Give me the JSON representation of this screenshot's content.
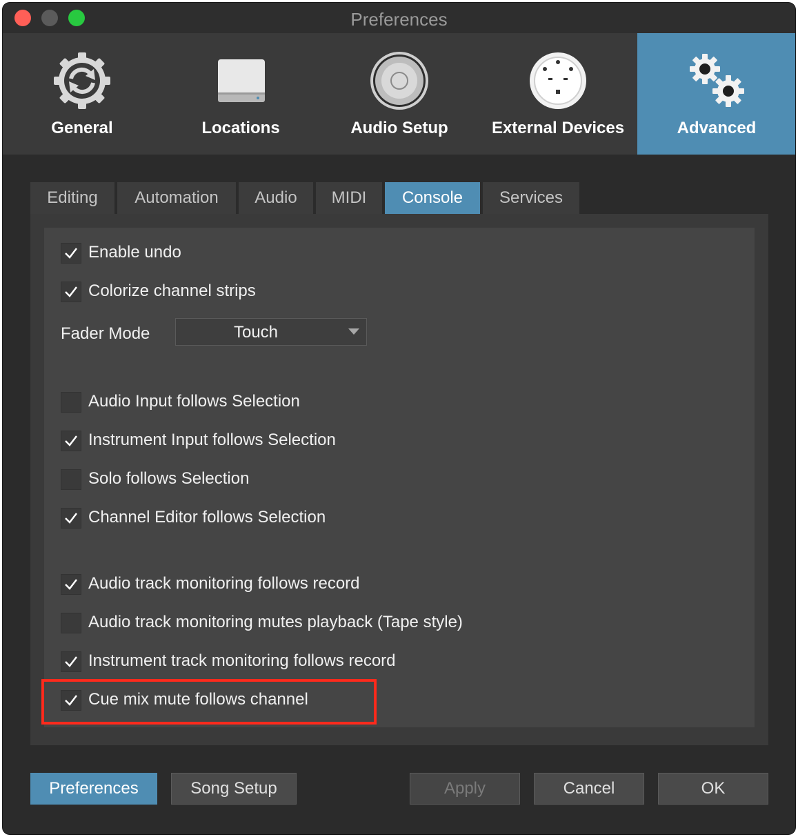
{
  "window": {
    "title": "Preferences"
  },
  "toolbar": {
    "items": [
      {
        "label": "General",
        "icon": "refresh-gear-icon"
      },
      {
        "label": "Locations",
        "icon": "drive-icon"
      },
      {
        "label": "Audio Setup",
        "icon": "speaker-icon"
      },
      {
        "label": "External Devices",
        "icon": "midi-port-icon"
      },
      {
        "label": "Advanced",
        "icon": "gears-icon",
        "active": true
      }
    ]
  },
  "tabs": [
    {
      "label": "Editing"
    },
    {
      "label": "Automation"
    },
    {
      "label": "Audio"
    },
    {
      "label": "MIDI"
    },
    {
      "label": "Console",
      "active": true
    },
    {
      "label": "Services"
    }
  ],
  "options": {
    "enable_undo": {
      "label": "Enable undo",
      "checked": true
    },
    "colorize_channel_strips": {
      "label": "Colorize channel strips",
      "checked": true
    },
    "fader_mode": {
      "label": "Fader Mode",
      "value": "Touch"
    },
    "audio_input_follows_selection": {
      "label": "Audio Input follows Selection",
      "checked": false
    },
    "instrument_input_follows_selection": {
      "label": "Instrument Input follows Selection",
      "checked": true
    },
    "solo_follows_selection": {
      "label": "Solo follows Selection",
      "checked": false
    },
    "channel_editor_follows_selection": {
      "label": "Channel Editor follows Selection",
      "checked": true
    },
    "audio_track_monitoring_follows_record": {
      "label": "Audio track monitoring follows record",
      "checked": true
    },
    "audio_track_monitoring_mutes_playback": {
      "label": "Audio track monitoring mutes playback (Tape style)",
      "checked": false
    },
    "instrument_track_monitoring_follows_record": {
      "label": "Instrument track monitoring follows record",
      "checked": true
    },
    "cue_mix_mute_follows_channel": {
      "label": "Cue mix mute follows channel",
      "checked": true
    }
  },
  "buttons": {
    "preferences": "Preferences",
    "song_setup": "Song Setup",
    "apply": "Apply",
    "cancel": "Cancel",
    "ok": "OK"
  },
  "colors": {
    "accent": "#4f8db3",
    "highlight": "#ff2a1c"
  }
}
